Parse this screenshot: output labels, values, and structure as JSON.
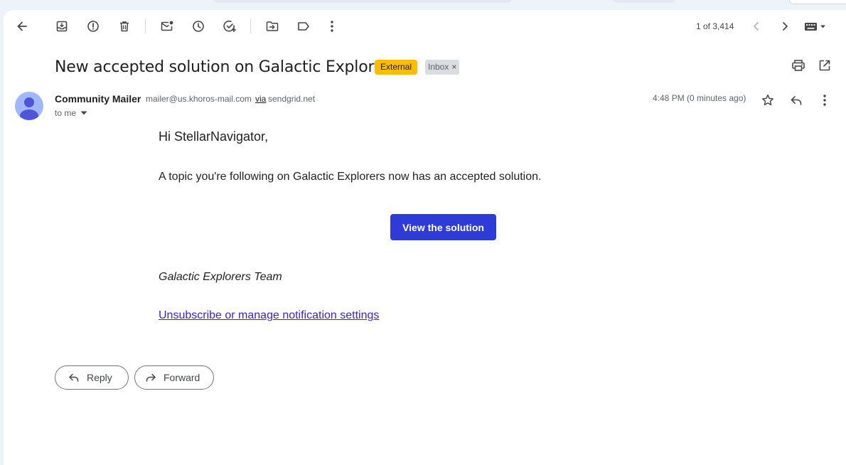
{
  "toolbar": {
    "back_icon": "arrow-left-icon",
    "archive_icon": "archive-icon",
    "report_spam_icon": "report-spam-icon",
    "delete_icon": "delete-icon",
    "mark_unread_icon": "mark-unread-icon",
    "snooze_icon": "snooze-icon",
    "add_task_icon": "add-task-icon",
    "move_to_icon": "move-to-icon",
    "labels_icon": "label-icon",
    "more_icon": "more-vert-icon",
    "counter": "1 of 3,414",
    "newer_icon": "chevron-left-icon",
    "older_icon": "chevron-right-icon",
    "input_tools_icon": "keyboard-icon"
  },
  "message": {
    "subject": "New accepted solution on Galactic Explorers",
    "labels": {
      "external": "External",
      "inbox": "Inbox",
      "remove_glyph": "×"
    },
    "sender": {
      "name": "Community Mailer",
      "email": "mailer@us.khoros-mail.com",
      "via": "via",
      "via_domain": "sendgrid.net"
    },
    "recipient": "to me",
    "timestamp": "4:48 PM (0 minutes ago)",
    "body": {
      "greeting": "Hi StellarNavigator,",
      "intro": "A topic you're following on Galactic Explorers now has an accepted solution.",
      "cta": "View the solution",
      "signature": "Galactic Explorers Team",
      "unsubscribe": "Unsubscribe or manage notification settings"
    }
  },
  "actions": {
    "reply": "Reply",
    "forward": "Forward"
  },
  "colors": {
    "cta": "#2f3bd6",
    "external_badge": "#fbbc04",
    "link": "#3c22d6",
    "avatar": "#a1b7fb"
  }
}
